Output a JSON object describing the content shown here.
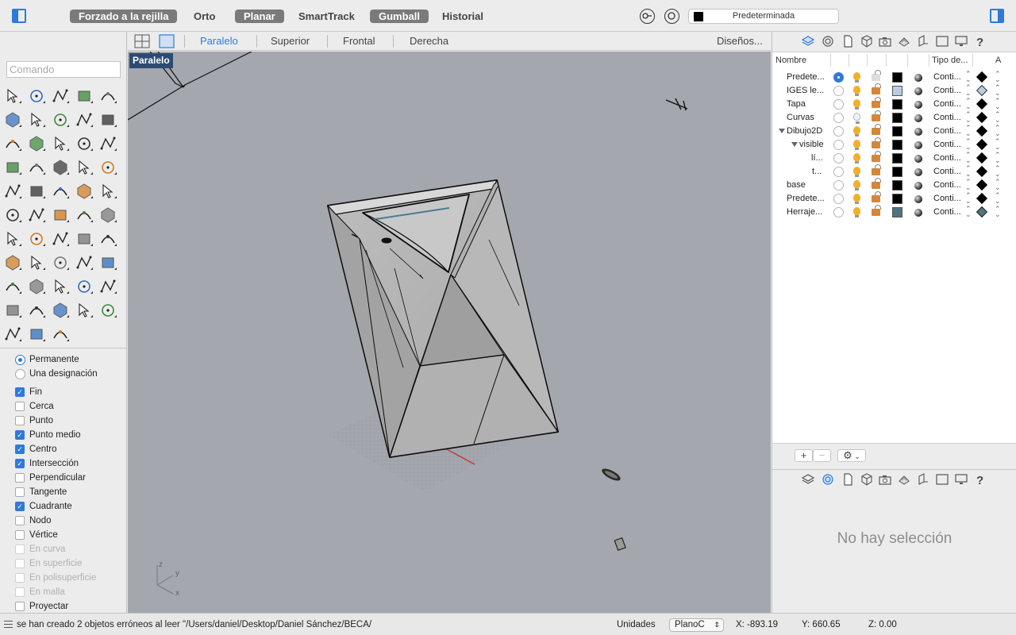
{
  "toolbar": {
    "toggles": [
      {
        "label": "Forzado a la rejilla",
        "active": true
      },
      {
        "label": "Orto",
        "active": false
      },
      {
        "label": "Planar",
        "active": true
      },
      {
        "label": "SmartTrack",
        "active": false
      },
      {
        "label": "Gumball",
        "active": true
      },
      {
        "label": "Historial",
        "active": false
      }
    ],
    "current_layer": "Predeterminada"
  },
  "command": {
    "placeholder": "Comando"
  },
  "osnap": {
    "mode_options": [
      {
        "label": "Permanente",
        "selected": true
      },
      {
        "label": "Una designación",
        "selected": false
      }
    ],
    "items": [
      {
        "label": "Fin",
        "checked": true,
        "enabled": true
      },
      {
        "label": "Cerca",
        "checked": false,
        "enabled": true
      },
      {
        "label": "Punto",
        "checked": false,
        "enabled": true
      },
      {
        "label": "Punto medio",
        "checked": true,
        "enabled": true
      },
      {
        "label": "Centro",
        "checked": true,
        "enabled": true
      },
      {
        "label": "Intersección",
        "checked": true,
        "enabled": true
      },
      {
        "label": "Perpendicular",
        "checked": false,
        "enabled": true
      },
      {
        "label": "Tangente",
        "checked": false,
        "enabled": true
      },
      {
        "label": "Cuadrante",
        "checked": true,
        "enabled": true
      },
      {
        "label": "Nodo",
        "checked": false,
        "enabled": true
      },
      {
        "label": "Vértice",
        "checked": false,
        "enabled": true
      },
      {
        "label": "En curva",
        "checked": false,
        "enabled": false
      },
      {
        "label": "En superficie",
        "checked": false,
        "enabled": false
      },
      {
        "label": "En polisuperficie",
        "checked": false,
        "enabled": false
      },
      {
        "label": "En malla",
        "checked": false,
        "enabled": false
      },
      {
        "label": "Proyectar",
        "checked": false,
        "enabled": true
      }
    ]
  },
  "viewport": {
    "tabs": [
      "Paralelo",
      "Superior",
      "Frontal",
      "Derecha"
    ],
    "active_tab": "Paralelo",
    "layouts_label": "Diseños...",
    "label": "Paralelo",
    "axes": {
      "z": "z",
      "y": "y",
      "x": "x"
    }
  },
  "layers": {
    "columns": {
      "name": "Nombre",
      "linetype": "Tipo de...",
      "extra": "A"
    },
    "rows": [
      {
        "name": "Predete...",
        "current": true,
        "on": true,
        "locked": false,
        "color": "#000000",
        "linetype": "Conti...",
        "print_color": "black"
      },
      {
        "name": "IGES le...",
        "current": false,
        "on": true,
        "locked": true,
        "color": "#b9cde2",
        "linetype": "Conti...",
        "print_color": "light"
      },
      {
        "name": "Tapa",
        "current": false,
        "on": true,
        "locked": true,
        "color": "#000000",
        "linetype": "Conti...",
        "print_color": "black"
      },
      {
        "name": "Curvas",
        "current": false,
        "on": false,
        "locked": true,
        "color": "#000000",
        "linetype": "Conti...",
        "print_color": "black"
      },
      {
        "name": "Dibujo2D",
        "current": false,
        "on": true,
        "locked": true,
        "color": "#000000",
        "linetype": "Conti...",
        "print_color": "black"
      },
      {
        "name": "visible",
        "current": false,
        "on": true,
        "locked": true,
        "color": "#000000",
        "linetype": "Conti...",
        "print_color": "black"
      },
      {
        "name": "lí...",
        "current": false,
        "on": true,
        "locked": true,
        "color": "#000000",
        "linetype": "Conti...",
        "print_color": "black"
      },
      {
        "name": "t...",
        "current": false,
        "on": true,
        "locked": true,
        "color": "#000000",
        "linetype": "Conti...",
        "print_color": "black"
      },
      {
        "name": "base",
        "current": false,
        "on": true,
        "locked": true,
        "color": "#000000",
        "linetype": "Conti...",
        "print_color": "black"
      },
      {
        "name": "Predete...",
        "current": false,
        "on": true,
        "locked": true,
        "color": "#000000",
        "linetype": "Conti...",
        "print_color": "black"
      },
      {
        "name": "Herraje...",
        "current": false,
        "on": true,
        "locked": true,
        "color": "#4f7480",
        "linetype": "Conti...",
        "print_color": "teal"
      }
    ]
  },
  "properties": {
    "empty_text": "No hay selección"
  },
  "status": {
    "message": "se han creado 2 objetos erróneos al leer \"/Users/daniel/Desktop/Daniel Sánchez/BECA/",
    "units_label": "Unidades",
    "plane": "PlanoC",
    "x": "X: -893.19",
    "y": "Y: 660.65",
    "z": "Z: 0.00"
  },
  "colors": {
    "accent": "#2f7ad9",
    "viewport_bg": "#a4a7ad",
    "viewport_label_bg": "#2c4b73"
  }
}
